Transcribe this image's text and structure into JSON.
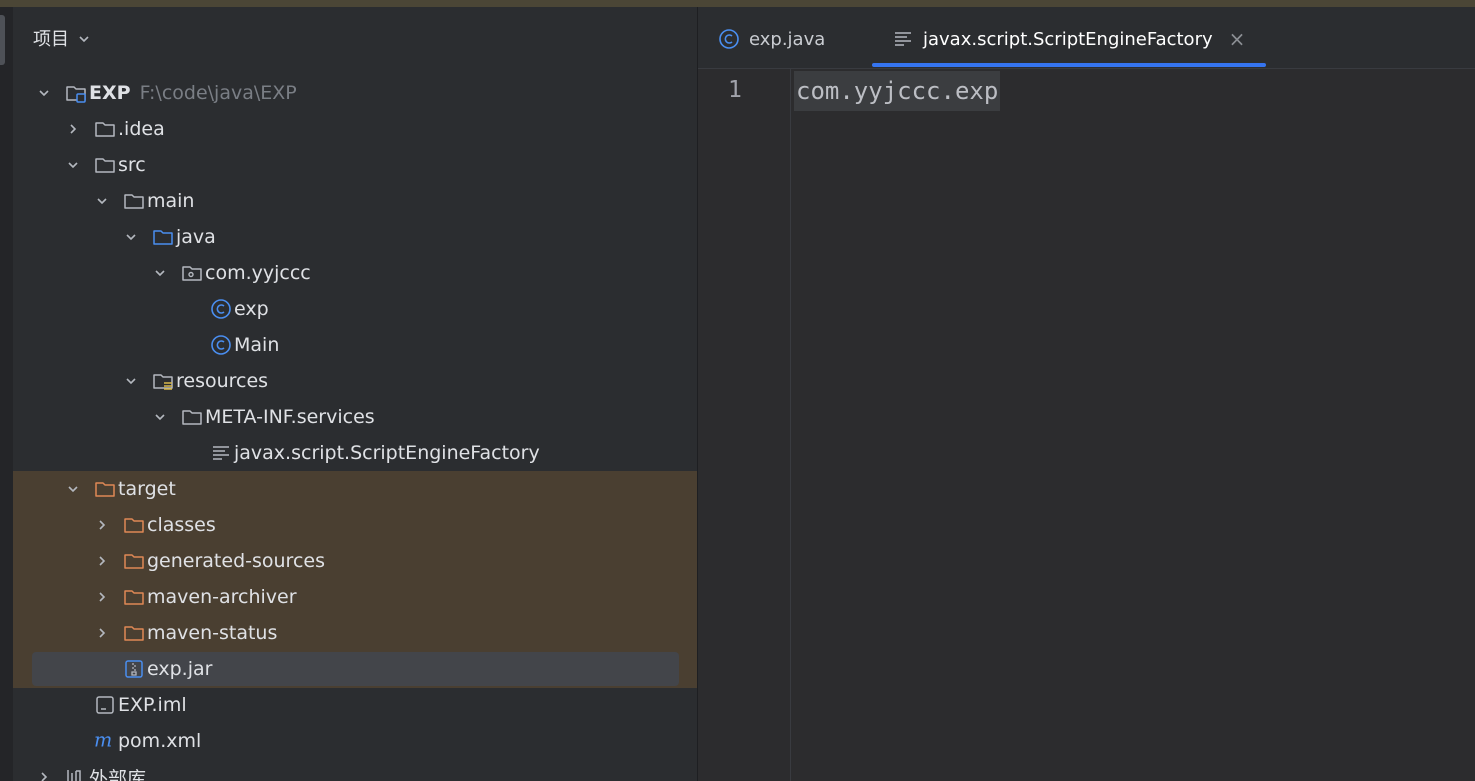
{
  "project_panel": {
    "title": "项目",
    "tree": [
      {
        "label": "EXP",
        "path": "F:\\code\\java\\EXP",
        "icon": "module-folder-icon",
        "expanded": true
      },
      {
        "label": ".idea",
        "icon": "folder-icon",
        "expanded": false
      },
      {
        "label": "src",
        "icon": "folder-icon",
        "expanded": true
      },
      {
        "label": "main",
        "icon": "folder-icon",
        "expanded": true
      },
      {
        "label": "java",
        "icon": "source-folder-icon",
        "expanded": true
      },
      {
        "label": "com.yyjccc",
        "icon": "package-icon",
        "expanded": true
      },
      {
        "label": "exp",
        "icon": "java-class-icon"
      },
      {
        "label": "Main",
        "icon": "java-class-icon"
      },
      {
        "label": "resources",
        "icon": "resources-folder-icon",
        "expanded": true
      },
      {
        "label": "META-INF.services",
        "icon": "folder-icon",
        "expanded": true
      },
      {
        "label": "javax.script.ScriptEngineFactory",
        "icon": "text-file-icon"
      },
      {
        "label": "target",
        "icon": "excluded-folder-icon",
        "expanded": true
      },
      {
        "label": "classes",
        "icon": "excluded-folder-icon",
        "expanded": false
      },
      {
        "label": "generated-sources",
        "icon": "excluded-folder-icon",
        "expanded": false
      },
      {
        "label": "maven-archiver",
        "icon": "excluded-folder-icon",
        "expanded": false
      },
      {
        "label": "maven-status",
        "icon": "excluded-folder-icon",
        "expanded": false
      },
      {
        "label": "exp.jar",
        "icon": "jar-file-icon",
        "selected": true
      },
      {
        "label": "EXP.iml",
        "icon": "iml-file-icon"
      },
      {
        "label": "pom.xml",
        "icon": "maven-icon"
      },
      {
        "label": "外部库",
        "icon": "library-icon",
        "expanded": false
      }
    ]
  },
  "editor": {
    "tabs": [
      {
        "label": "exp.java",
        "icon": "java-class-icon",
        "active": false
      },
      {
        "label": "javax.script.ScriptEngineFactory",
        "icon": "text-file-icon",
        "active": true,
        "close": "×"
      }
    ],
    "lines": [
      {
        "number": "1",
        "text": "com.yyjccc.exp"
      }
    ]
  },
  "colors": {
    "accent": "#3574f0",
    "excluded_folder": "#e08855",
    "java_class": "#4a8ef0",
    "text": "#dfe1e5",
    "muted_path": "#7a7e85"
  }
}
